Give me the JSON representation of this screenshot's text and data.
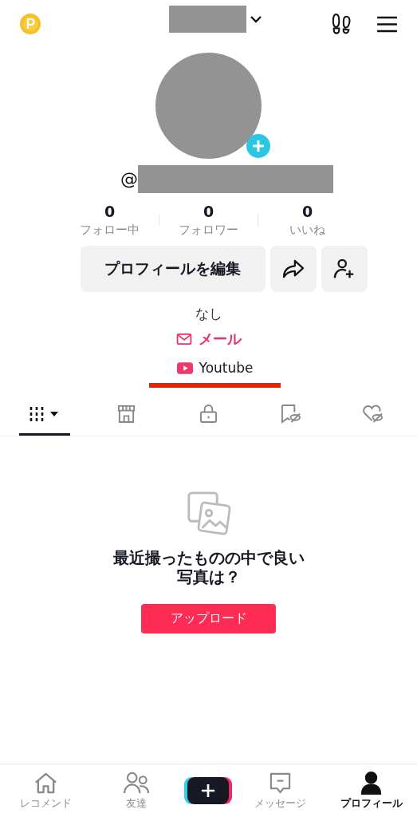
{
  "header": {
    "username_redacted": true
  },
  "profile": {
    "handle_prefix": "@",
    "has_add_badge": true
  },
  "stats": [
    {
      "value": "0",
      "label": "フォロー中"
    },
    {
      "value": "0",
      "label": "フォロワー"
    },
    {
      "value": "0",
      "label": "いいね"
    }
  ],
  "actions": {
    "edit_label": "プロフィールを編集"
  },
  "bio": "なし",
  "links": [
    {
      "kind": "mail",
      "label": "メール"
    },
    {
      "kind": "youtube",
      "label": "Youtube"
    }
  ],
  "content_tabs": [
    {
      "kind": "grid",
      "selected": true
    },
    {
      "kind": "shop",
      "selected": false
    },
    {
      "kind": "lock",
      "selected": false
    },
    {
      "kind": "bookmark",
      "selected": false
    },
    {
      "kind": "heart",
      "selected": false
    }
  ],
  "empty_state": {
    "message": "最近撮ったものの中で良い写真は？",
    "button": "アップロード"
  },
  "bottom_nav": [
    {
      "kind": "home",
      "label": "レコメンド",
      "selected": false
    },
    {
      "kind": "friends",
      "label": "友達",
      "selected": false
    },
    {
      "kind": "create",
      "selected": false
    },
    {
      "kind": "inbox",
      "label": "メッセージ",
      "selected": false
    },
    {
      "kind": "profile",
      "label": "プロフィール",
      "selected": true
    }
  ]
}
